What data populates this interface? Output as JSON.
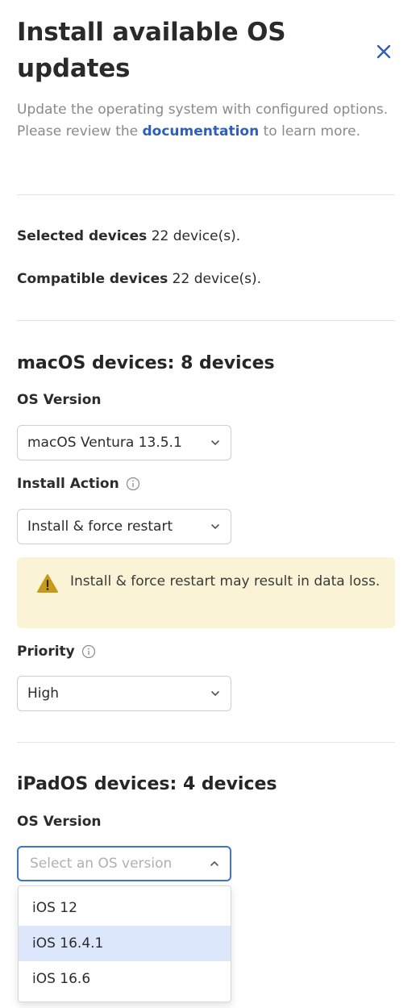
{
  "header": {
    "title": "Install available OS updates",
    "description_prefix": "Update the operating system with configured options. Please review the ",
    "description_link": "documentation",
    "description_suffix": " to learn more."
  },
  "summary": {
    "selected_label": "Selected devices",
    "selected_value": "22 device(s).",
    "compatible_label": "Compatible devices",
    "compatible_value": "22 device(s)."
  },
  "macos": {
    "heading": "macOS devices: 8 devices",
    "os_version_label": "OS Version",
    "os_version_value": "macOS Ventura 13.5.1",
    "install_action_label": "Install Action",
    "install_action_value": "Install & force restart",
    "warning_text": "Install & force restart may result in data loss.",
    "priority_label": "Priority",
    "priority_value": "High"
  },
  "ipados": {
    "heading": "iPadOS devices: 4 devices",
    "os_version_label": "OS Version",
    "os_version_placeholder": "Select an OS version",
    "options": [
      "iOS 12",
      "iOS 16.4.1",
      "iOS 16.6"
    ]
  },
  "colors": {
    "link": "#2f5fb8",
    "focus_border": "#3b73d6",
    "warning_bg": "#faf3d6",
    "warning_icon": "#c79a1e",
    "option_highlight": "#dde7fb"
  }
}
